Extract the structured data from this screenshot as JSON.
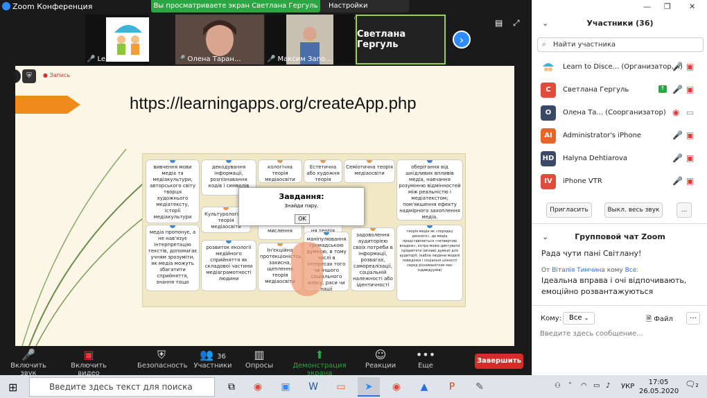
{
  "window": {
    "title": "Zoom Конференция"
  },
  "share_banner": {
    "text": "Вы просматриваете экран Светлана Гергуль"
  },
  "view_options": {
    "label": "Настройки просмотра ▾"
  },
  "thumbnails": [
    {
      "caption": "Learn to Disc..."
    },
    {
      "caption": "Олена Таран..."
    },
    {
      "caption": "Максим Запо..."
    },
    {
      "caption": "Светлана Гергуль"
    }
  ],
  "slide": {
    "url": "https://learningapps.org/createApp.php",
    "recording": "Запись",
    "cards": [
      "вивчення мови медіа та медіакультури, авторського світу творця художнього медіатексту, історії медіакультури",
      "декодування інформації, розпізнавання кодів і символів",
      "кологічна теорія медіаосвіти",
      "Естетична або художня теорія медіаосвіти",
      "Семіотична теорія медіаосвіти",
      "оберігання від шкідливих впливів медіа, навчання розумінню відмінностей між реальністю і медіатекстом; пом'якшення ефекту надмірного захоплення медіа.",
      "Культурологічна теорія медіаосвіти",
      "мислення",
      "ня теорія освіти",
      "медіа пропонує, а не нав'язує інтерпретацію текстів, допомагає учням зрозуміти, як медіа можуть збагатити сприйняття, знання тощо",
      "розвиток екології медійного сприйняття як складової частини медіаграмотності людини",
      "Ін'єкційна протекціоністська, захисна, щеплення теорія медіаосвіти",
      "маніпулювання громадською думкою, в тому числі в інтересах того чи іншого соціального класу, раси чи нації",
      "задоволення аудиторією своїх потреби в інформації, розвагах, самореалізації, соціальній належності або ідентичності",
      "теорія медіа як «порядку денного», де медіа представляється «четвертою владою», котра може диктувати пріоритети (вплив) думки) для аудиторії; (кабла людини моделі поведінки і соціальні цінності серед різноманітних мас індивідуумів)"
    ],
    "dialog": {
      "title": "Завдання:",
      "text": "Знайди пару.",
      "ok": "OK"
    }
  },
  "toolbar": {
    "mute": "Включить звук",
    "video": "Включить видео",
    "security": "Безопасность",
    "participants": "Участники",
    "participants_count": "36",
    "polls": "Опросы",
    "share": "Демонстрация экрана",
    "reactions": "Реакции",
    "more": "Еще",
    "end": "Завершить"
  },
  "panel": {
    "participants_title": "Участники (36)",
    "search_placeholder": "Найти участника",
    "participants": [
      {
        "initials": "",
        "name": "Learn to Disce... (Организатор, я)",
        "color": "#ffffff"
      },
      {
        "initials": "С",
        "name": "Светлана Гергуль",
        "color": "#e04c3c"
      },
      {
        "initials": "О",
        "name": "Олена Та... (Соорганизатор)",
        "color": "#3a4a66"
      },
      {
        "initials": "AI",
        "name": "Administrator's iPhone",
        "color": "#e8642a"
      },
      {
        "initials": "HD",
        "name": "Halyna Dehtiarova",
        "color": "#3a4a66"
      },
      {
        "initials": "IV",
        "name": "iPhone VTR",
        "color": "#e04c3c"
      }
    ],
    "invite": "Пригласить",
    "mute_all": "Выкл. весь звук",
    "more": "...",
    "chat_title": "Групповой чат Zoom",
    "messages": [
      {
        "text": "Рада чути пані Світлану!"
      },
      {
        "from_prefix": "От ",
        "from": "Віталія Тимчина",
        "to_prefix": " кому ",
        "to": "Все:",
        "text": "Ідеальна вправа і очі відпочивають, емоційно розвантажуються"
      }
    ],
    "to_label": "Кому:",
    "to_value": "Все",
    "file": "Файл",
    "chat_placeholder": "Введите здесь сообщение..."
  },
  "taskbar": {
    "search": "Введите здесь текст для поиска",
    "lang": "УКР",
    "time": "17:05",
    "date": "26.05.2020",
    "notifications": "2"
  }
}
